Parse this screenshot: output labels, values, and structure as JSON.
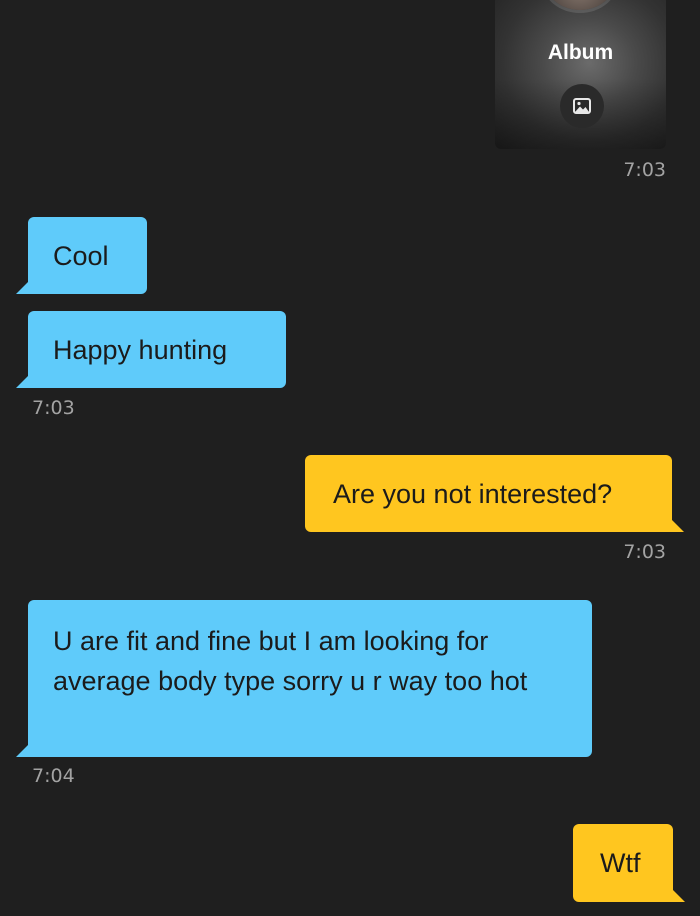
{
  "colors": {
    "background": "#1f1f1f",
    "incoming_bubble": "#5fcbfa",
    "outgoing_bubble": "#ffc61f",
    "timestamp": "#a3a3a3"
  },
  "album": {
    "label": "Album",
    "icon": "image-icon",
    "time": "7:03"
  },
  "messages": [
    {
      "direction": "incoming",
      "text": "Cool"
    },
    {
      "direction": "incoming",
      "text": "Happy hunting",
      "time": "7:03"
    },
    {
      "direction": "outgoing",
      "text": "Are you not interested?",
      "time": "7:03"
    },
    {
      "direction": "incoming",
      "text": "U are fit and fine but I am looking for average body type sorry u r way too hot",
      "time": "7:04"
    },
    {
      "direction": "outgoing",
      "text": "Wtf"
    }
  ]
}
